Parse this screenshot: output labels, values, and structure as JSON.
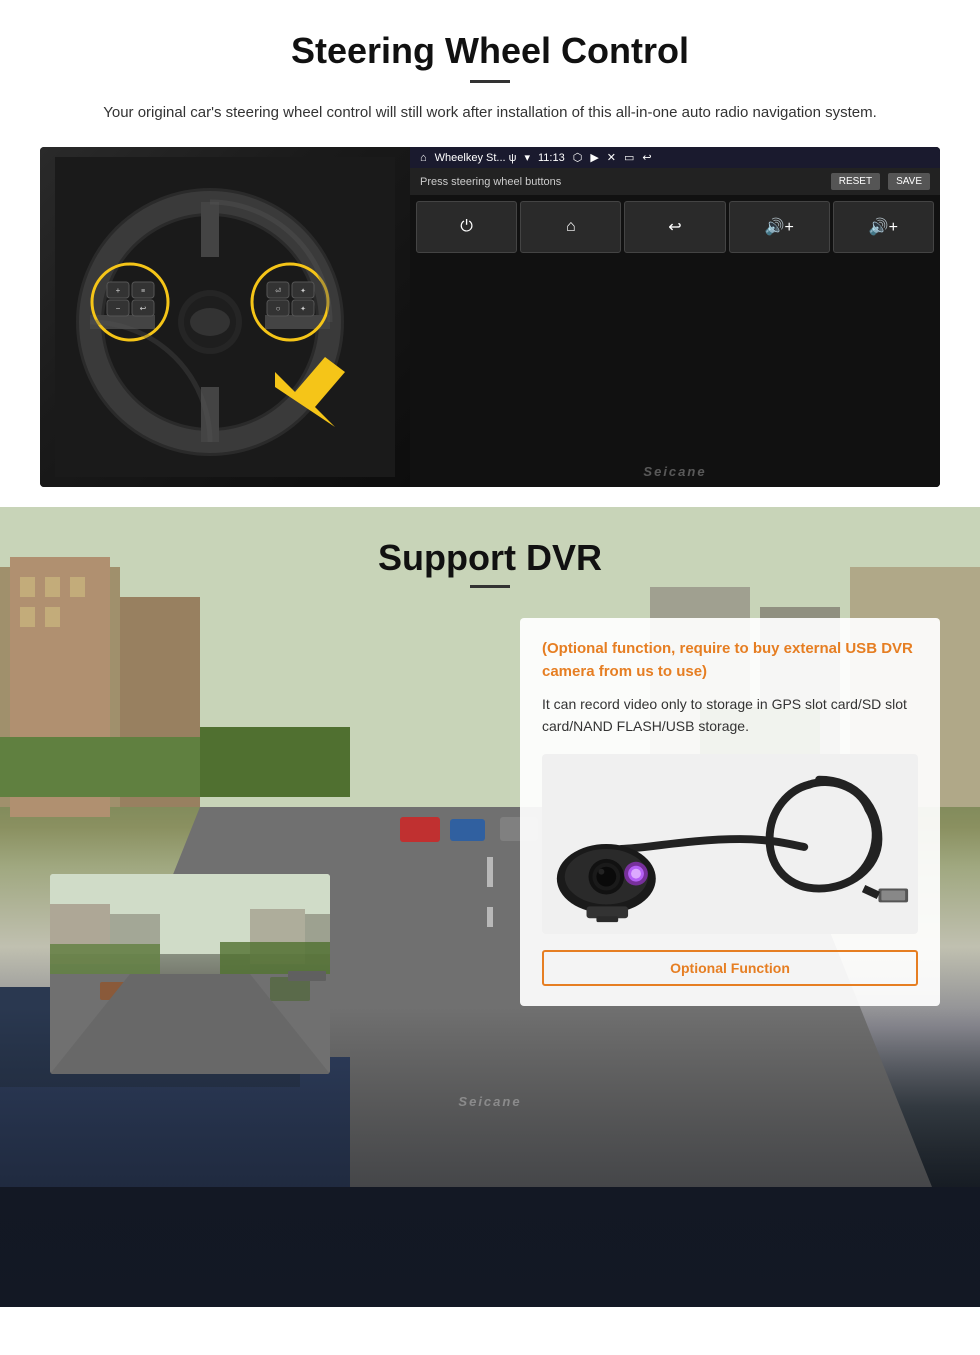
{
  "steering": {
    "title": "Steering Wheel Control",
    "description": "Your original car's steering wheel control will still work after installation of this all-in-one auto radio navigation system.",
    "hu": {
      "app_title": "Wheelkey St... ψ",
      "time": "11:13",
      "prompt": "Press steering wheel buttons",
      "reset_btn": "RESET",
      "save_btn": "SAVE",
      "controls": [
        "⏻",
        "🏠",
        "↩",
        "🔊+",
        "🔊+"
      ]
    },
    "watermark": "Seicane"
  },
  "dvr": {
    "title": "Support DVR",
    "optional_label": "(Optional function, require to buy external USB DVR camera from us to use)",
    "description": "It can record video only to storage in GPS slot card/SD slot card/NAND FLASH/USB storage.",
    "optional_badge": "Optional Function",
    "watermark": "Seicane"
  }
}
